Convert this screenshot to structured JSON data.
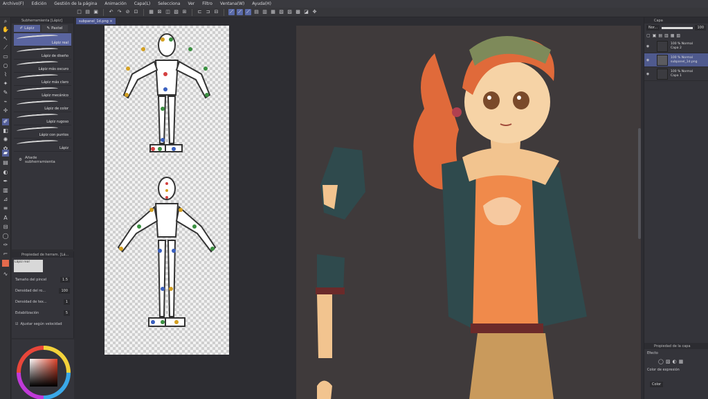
{
  "menu": [
    "Archivo(F)",
    "Edición",
    "Gestión de la página",
    "Animación",
    "Capa(L)",
    "Selecciona",
    "Ver",
    "Filtro",
    "Ventana(W)",
    "Ayuda(H)"
  ],
  "doc_tab": "subpanel_1d.png ×",
  "subtool": {
    "title": "Subherramienta [Lápiz]",
    "tabs": [
      "Lápiz",
      "Pastel"
    ],
    "brushes": [
      "Lápiz real",
      "Lápiz de diseño",
      "Lápiz más oscuro",
      "Lápiz más claro",
      "Lápiz mecánico",
      "Lápiz de color",
      "Lápiz rugoso",
      "Lápiz con puntos",
      "Lápiz"
    ],
    "add_label": "Añade subherramienta"
  },
  "toolprop": {
    "title": "Propiedad de herram. [Lá...",
    "swatch": "Lápiz real",
    "rows": [
      {
        "label": "Tamaño del pincel",
        "value": "1.5"
      },
      {
        "label": "Densidad del ro...",
        "value": "100"
      },
      {
        "label": "Densidad de tex...",
        "value": "1"
      },
      {
        "label": "Estabilización",
        "value": "5"
      }
    ],
    "checkbox": "Ajustar según velocidad"
  },
  "layers": {
    "title": "Capa",
    "blend": "Nor...",
    "opacity": "100",
    "items": [
      {
        "line1": "100 % Normal",
        "line2": "Capa 2",
        "selected": false
      },
      {
        "line1": "100 % Normal",
        "line2": "subpanel_1d.png",
        "selected": true
      },
      {
        "line1": "100 % Normal",
        "line2": "Capa 1",
        "selected": false
      }
    ]
  },
  "layerprop": {
    "title": "Propiedad de la capa",
    "effect": "Efecto",
    "expression": "Color de expresión",
    "color_value": "Color"
  },
  "colors": {
    "accent": "#55609a",
    "hair": "#e06a3a",
    "jacket": "#2f4a4d",
    "shirt": "#f08a4b"
  }
}
